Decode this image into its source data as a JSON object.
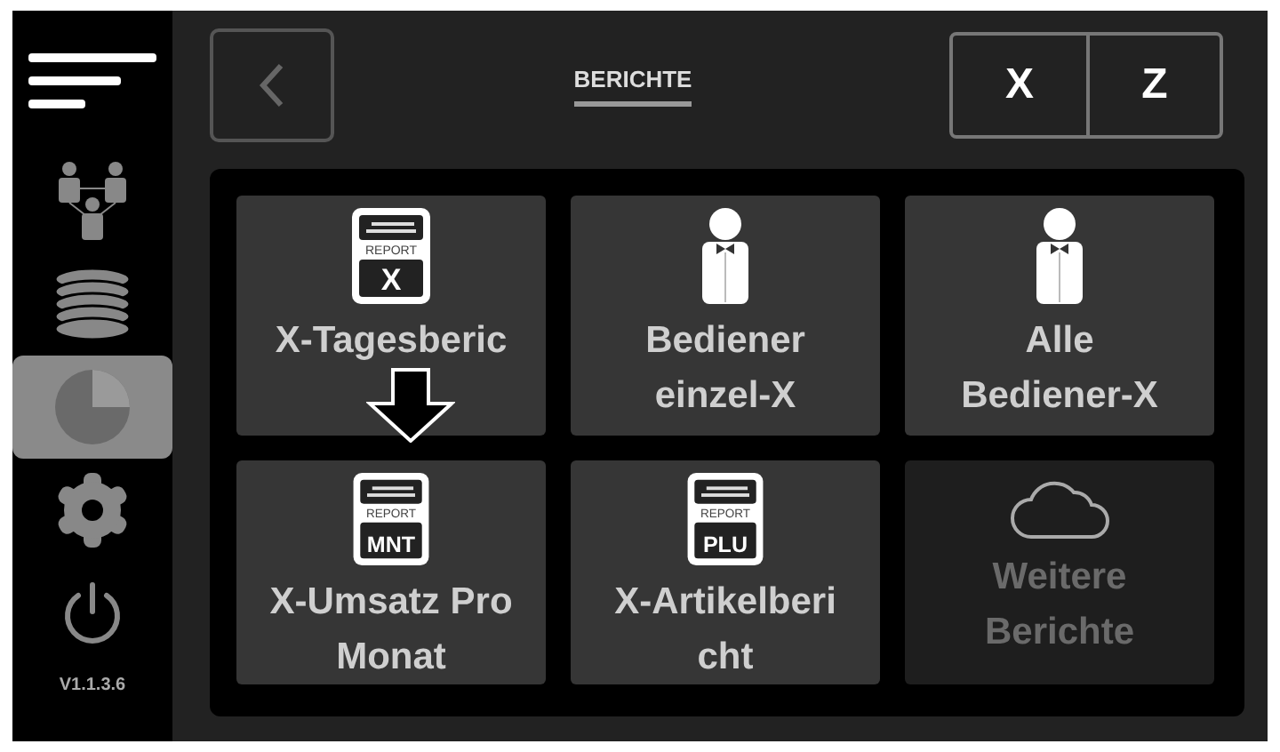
{
  "sidebar": {
    "items": [
      {
        "kind": "menu",
        "selected": false
      },
      {
        "kind": "network",
        "selected": false
      },
      {
        "kind": "database",
        "selected": false
      },
      {
        "kind": "reports",
        "selected": true
      },
      {
        "kind": "settings",
        "selected": false
      },
      {
        "kind": "power",
        "selected": false
      }
    ],
    "version": "V1.1.3.6"
  },
  "header": {
    "title": "BERICHTE",
    "mode_buttons": [
      "X",
      "Z"
    ]
  },
  "tiles": [
    {
      "kind": "report",
      "report_label": "REPORT",
      "badge": "X",
      "label": [
        "X-Tagesberic"
      ],
      "disabled": false
    },
    {
      "kind": "waiter",
      "label": [
        "Bediener",
        "einzel-X"
      ],
      "disabled": false
    },
    {
      "kind": "waiter",
      "label": [
        "Alle",
        "Bediener-X"
      ],
      "disabled": false
    },
    {
      "kind": "report",
      "report_label": "REPORT",
      "badge": "MNT",
      "label": [
        "X-Umsatz Pro",
        "Monat"
      ],
      "disabled": false
    },
    {
      "kind": "report",
      "report_label": "REPORT",
      "badge": "PLU",
      "label": [
        "X-Artikelberi",
        "cht"
      ],
      "disabled": false
    },
    {
      "kind": "cloud",
      "label": [
        "Weitere",
        "Berichte"
      ],
      "disabled": true
    }
  ]
}
